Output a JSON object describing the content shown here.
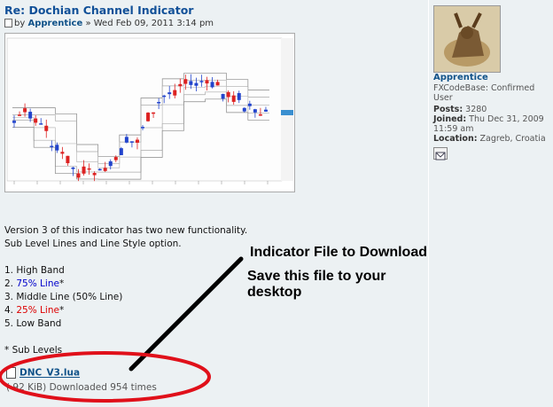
{
  "post": {
    "title": "Re: Dochian Channel Indicator",
    "by_prefix": "by",
    "author": "Apprentice",
    "date": "» Wed Feb 09, 2011 3:14 pm"
  },
  "content": {
    "intro1": "Version 3 of this indicator has two new functionality.",
    "intro2": "Sub Level Lines and Line Style option.",
    "items": [
      {
        "num": "1.",
        "text": "High Band",
        "extra": ""
      },
      {
        "num": "2.",
        "text": "75% Line",
        "extra": "*"
      },
      {
        "num": "3.",
        "text": "Middle Line (50% Line)",
        "extra": ""
      },
      {
        "num": "4.",
        "text": "25% Line",
        "extra": "*"
      },
      {
        "num": "5.",
        "text": "Low Band",
        "extra": ""
      }
    ],
    "footnote": "* Sub Levels"
  },
  "attachment": {
    "filename": "DNC_V3.lua",
    "meta": "( 92 KiB) Downloaded 954 times"
  },
  "annotations": {
    "line1": "Indicator File to Download",
    "line2": "Save this file to your desktop"
  },
  "profile": {
    "username": "Apprentice",
    "rank": "FXCodeBase: Confirmed User",
    "posts_label": "Posts:",
    "posts_value": "3280",
    "joined_label": "Joined:",
    "joined_value": "Thu Dec 31, 2009 11:59 am",
    "location_label": "Location:",
    "location_value": "Zagreb, Croatia"
  },
  "colors": {
    "title": "#115098",
    "link": "#105289",
    "annotation_ellipse": "#e0101a",
    "bull_candle": "#2244cc",
    "bear_candle": "#dd2222"
  },
  "icons": {
    "post": "post-icon",
    "file": "file-icon",
    "pm": "pm-envelope-icon"
  }
}
